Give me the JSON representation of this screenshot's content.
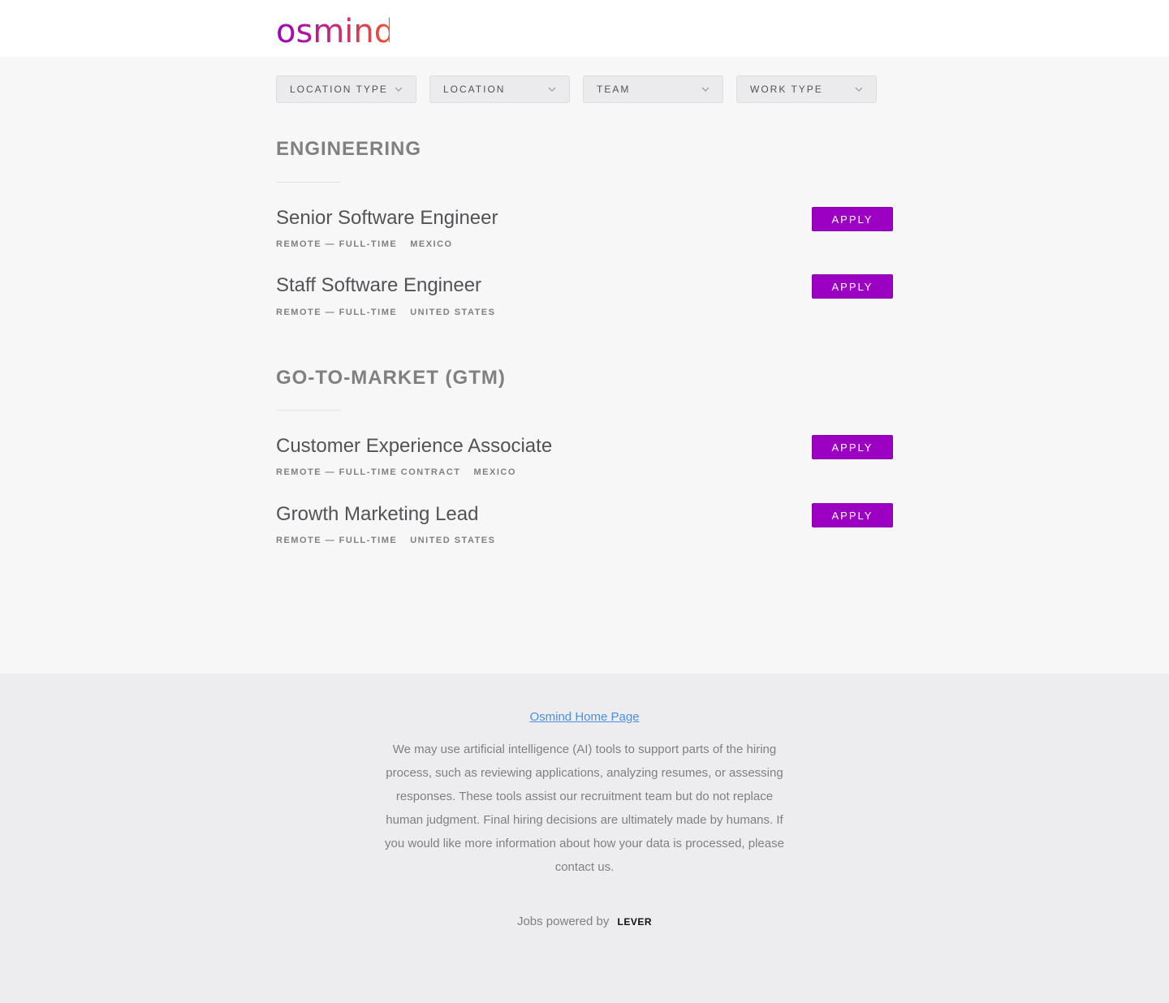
{
  "brand": {
    "name": "osmind",
    "gradient_start": "#9c00c3",
    "gradient_end": "#f0552c"
  },
  "filters": [
    {
      "label": "LOCATION TYPE"
    },
    {
      "label": "LOCATION"
    },
    {
      "label": "TEAM"
    },
    {
      "label": "WORK TYPE"
    }
  ],
  "groups": [
    {
      "title": "ENGINEERING",
      "postings": [
        {
          "title": "Senior Software Engineer",
          "commitment": "REMOTE — FULL-TIME",
          "location": "MEXICO",
          "apply": "APPLY"
        },
        {
          "title": "Staff Software Engineer",
          "commitment": "REMOTE — FULL-TIME",
          "location": "UNITED STATES",
          "apply": "APPLY"
        }
      ]
    },
    {
      "title": "GO-TO-MARKET (GTM)",
      "postings": [
        {
          "title": "Customer Experience Associate",
          "commitment": "REMOTE — FULL-TIME CONTRACT",
          "location": "MEXICO",
          "apply": "APPLY"
        },
        {
          "title": "Growth Marketing Lead",
          "commitment": "REMOTE — FULL-TIME",
          "location": "UNITED STATES",
          "apply": "APPLY"
        }
      ]
    }
  ],
  "footer": {
    "home_link": "Osmind Home Page",
    "disclaimer": "We may use artificial intelligence (AI) tools to support parts of the hiring process, such as reviewing applications, analyzing resumes, or assessing responses. These tools assist our recruitment team but do not replace human judgment. Final hiring decisions are ultimately made by humans. If you would like more information about how your data is processed, please contact us.",
    "powered_by": "Jobs powered by",
    "lever": "LEVER"
  },
  "colors": {
    "accent": "#9c00c3",
    "link": "#4a90e2"
  }
}
